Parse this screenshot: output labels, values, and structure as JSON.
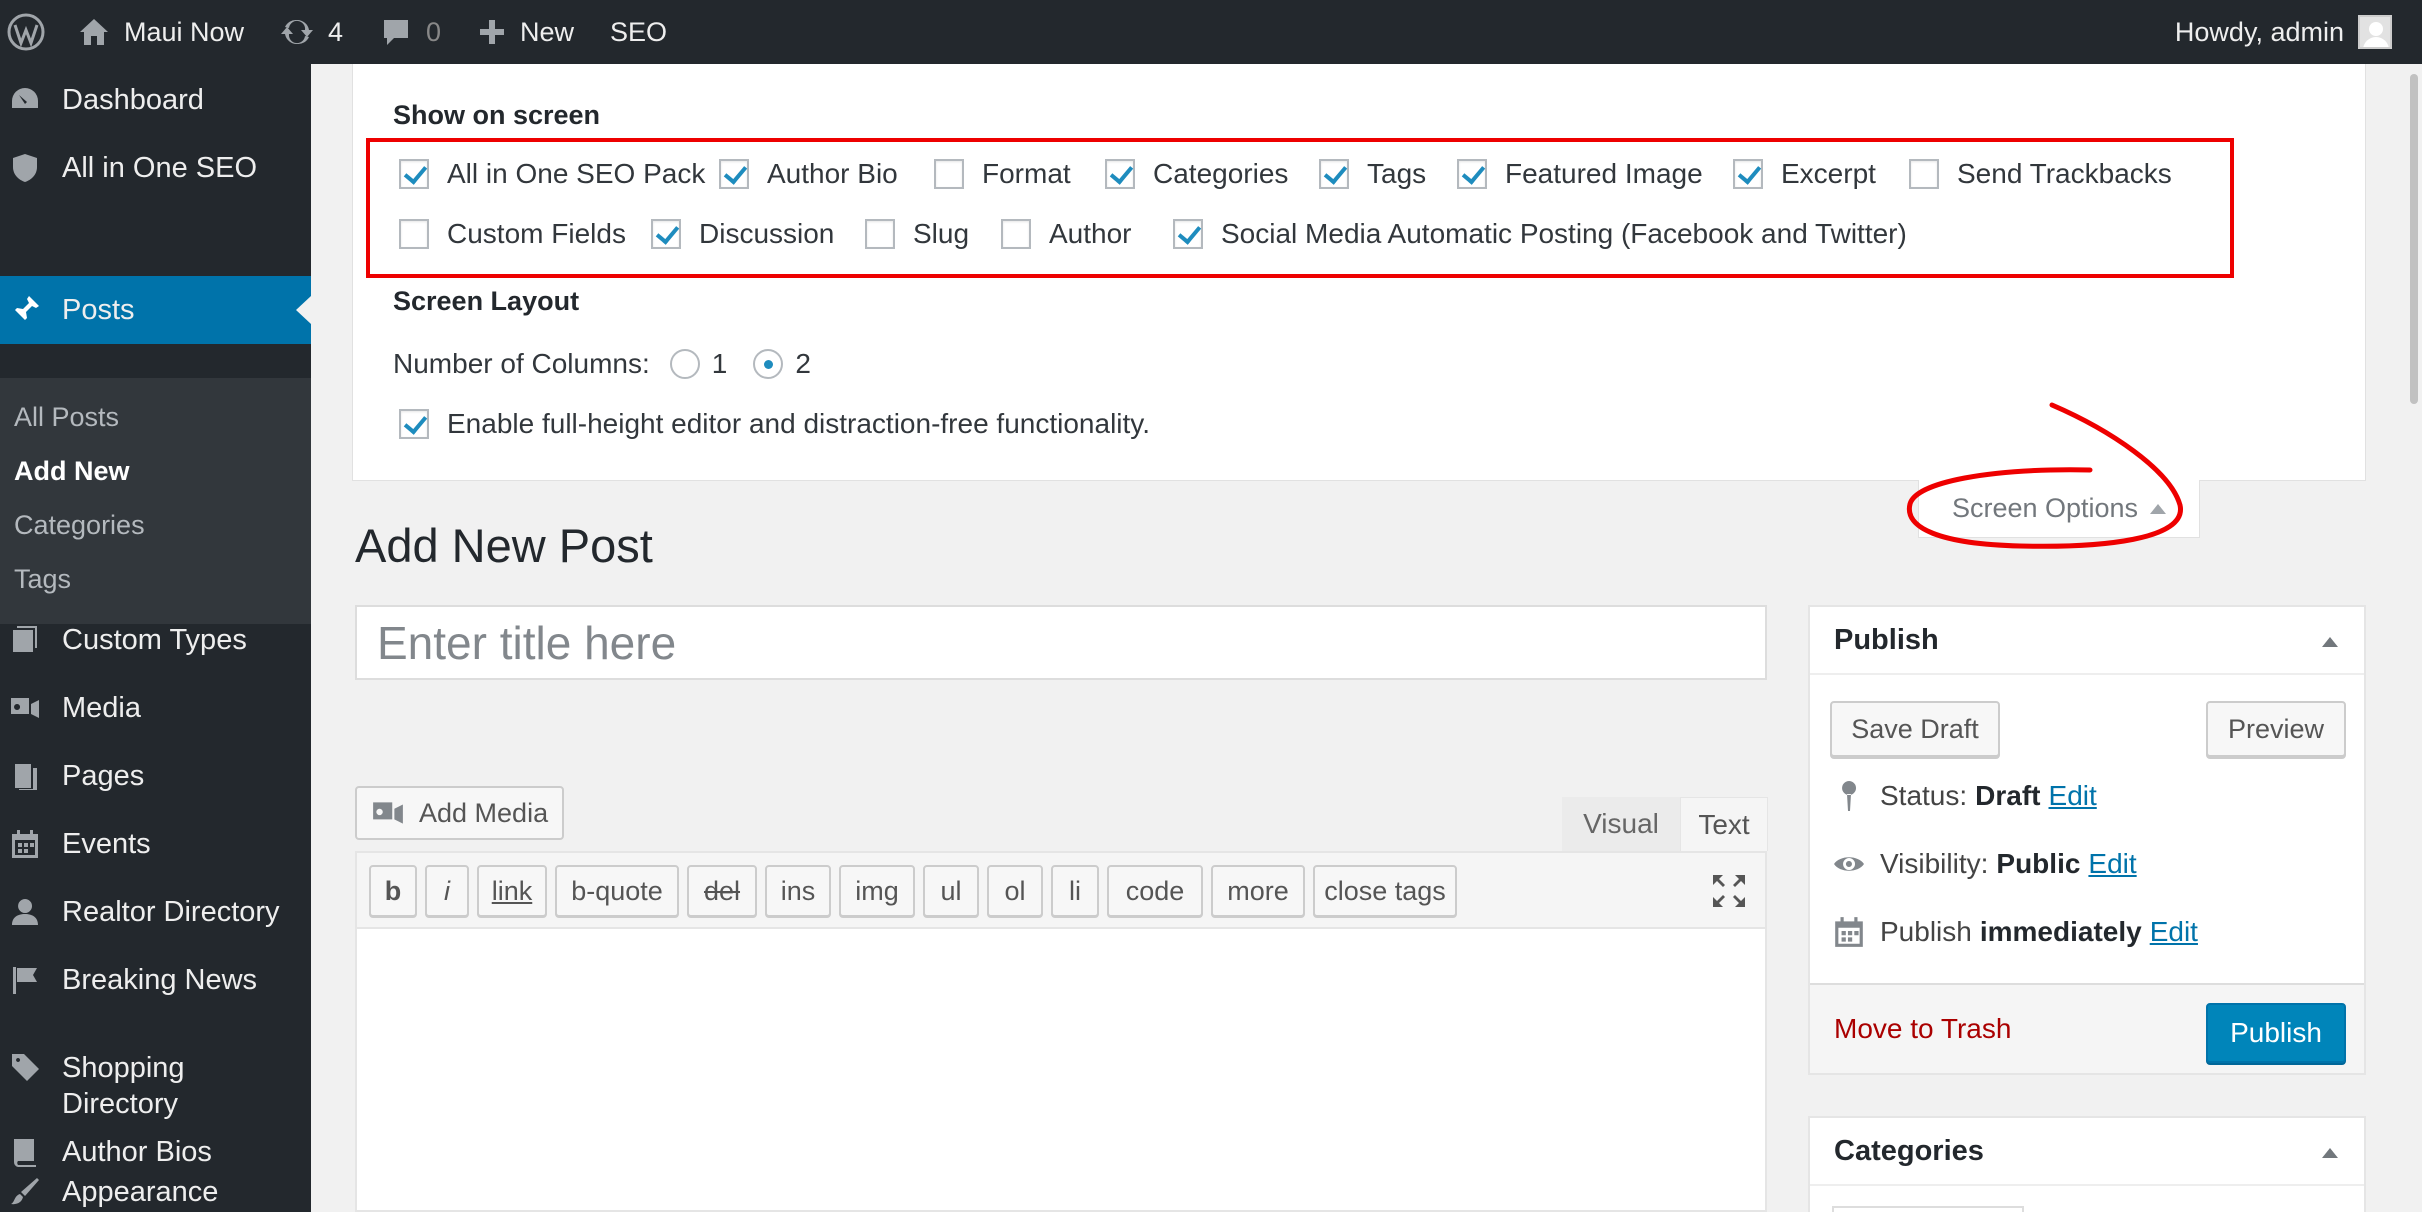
{
  "admin_bar": {
    "site_name": "Maui Now",
    "updates_count": "4",
    "comments_count": "0",
    "new_label": "New",
    "seo_label": "SEO",
    "account_label": "Howdy, admin"
  },
  "sidebar": {
    "items": [
      {
        "label": "Dashboard",
        "icon": "dashboard-icon"
      },
      {
        "label": "All in One SEO",
        "icon": "shield-icon"
      },
      {
        "label": "Posts",
        "icon": "pushpin-icon"
      },
      {
        "label": "Custom Types",
        "icon": "custom-types-icon"
      },
      {
        "label": "Media",
        "icon": "media-icon"
      },
      {
        "label": "Pages",
        "icon": "pages-icon"
      },
      {
        "label": "Events",
        "icon": "calendar-icon"
      },
      {
        "label": "Realtor Directory",
        "icon": "user-icon"
      },
      {
        "label": "Breaking News",
        "icon": "flag-icon"
      },
      {
        "label": "Shopping Directory",
        "icon": "tag-icon"
      },
      {
        "label": "Author Bios",
        "icon": "book-icon"
      },
      {
        "label": "Appearance",
        "icon": "brush-icon"
      }
    ],
    "posts_submenu": [
      "All Posts",
      "Add New",
      "Categories",
      "Tags"
    ]
  },
  "screen_options": {
    "show_on_screen_heading": "Show on screen",
    "checkboxes": [
      {
        "label": "All in One SEO Pack",
        "checked": true
      },
      {
        "label": "Author Bio",
        "checked": true
      },
      {
        "label": "Format",
        "checked": false
      },
      {
        "label": "Categories",
        "checked": true
      },
      {
        "label": "Tags",
        "checked": true
      },
      {
        "label": "Featured Image",
        "checked": true
      },
      {
        "label": "Excerpt",
        "checked": true
      },
      {
        "label": "Send Trackbacks",
        "checked": false
      },
      {
        "label": "Custom Fields",
        "checked": false
      },
      {
        "label": "Discussion",
        "checked": true
      },
      {
        "label": "Slug",
        "checked": false
      },
      {
        "label": "Author",
        "checked": false
      },
      {
        "label": "Social Media Automatic Posting (Facebook and Twitter)",
        "checked": true
      }
    ],
    "layout_heading": "Screen Layout",
    "columns_label": "Number of Columns:",
    "column_options": [
      "1",
      "2"
    ],
    "selected_columns": "2",
    "fullheight_label": "Enable full-height editor and distraction-free functionality.",
    "fullheight_checked": true,
    "tab_label": "Screen Options"
  },
  "main": {
    "page_title": "Add New Post",
    "title_placeholder": "Enter title here",
    "add_media_label": "Add Media",
    "tab_visual": "Visual",
    "tab_text": "Text",
    "quicktags": [
      "b",
      "i",
      "link",
      "b-quote",
      "del",
      "ins",
      "img",
      "ul",
      "ol",
      "li",
      "code",
      "more",
      "close tags"
    ]
  },
  "publish_box": {
    "title": "Publish",
    "save_draft": "Save Draft",
    "preview": "Preview",
    "status_label": "Status:",
    "status_value": "Draft",
    "visibility_label": "Visibility:",
    "visibility_value": "Public",
    "publish_label": "Publish",
    "publish_value": "immediately",
    "edit_link": "Edit",
    "trash_label": "Move to Trash",
    "publish_button": "Publish"
  },
  "categories_box": {
    "title": "Categories"
  },
  "colors": {
    "admin_dark": "#23282d",
    "accent_blue": "#0073aa",
    "primary_button": "#0085ba",
    "annotation_red": "#e00000",
    "trash_red": "#a00000"
  }
}
